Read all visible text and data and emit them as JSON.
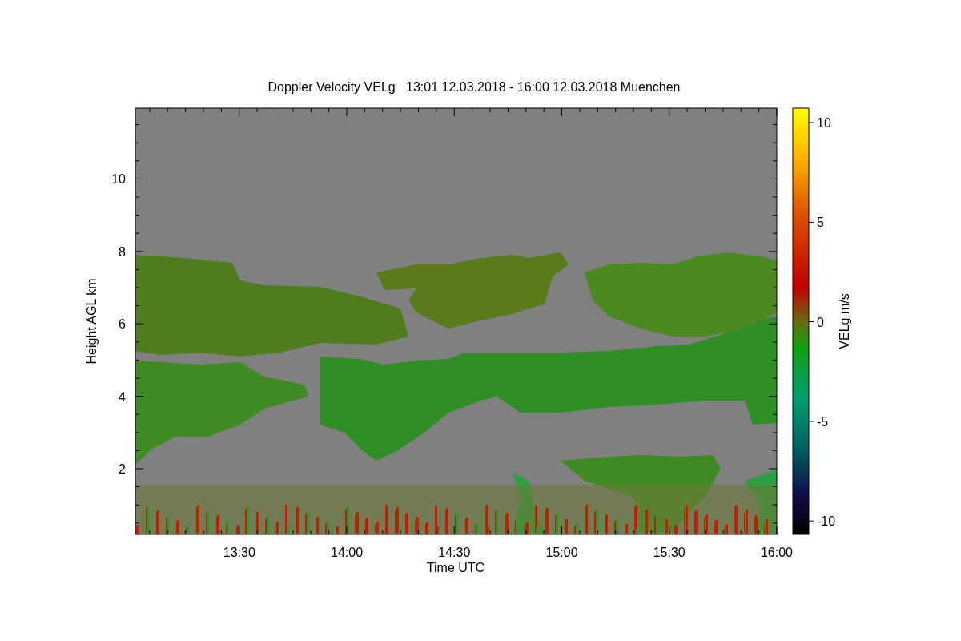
{
  "title": "Doppler Velocity VELg   13:01 12.03.2018 - 16:00 12.03.2018 Muenchen",
  "y_axis": {
    "label": "Height AGL km",
    "ticks": [
      "10",
      "8",
      "6",
      "4",
      "2"
    ]
  },
  "x_axis": {
    "label": "Time UTC",
    "ticks": [
      "13:30",
      "14:00",
      "14:30",
      "15:00",
      "15:30",
      "16:00"
    ]
  },
  "colorbar": {
    "label": "VELg m/s",
    "ticks": [
      "10",
      "5",
      "0",
      "-5",
      "-10"
    ]
  }
}
